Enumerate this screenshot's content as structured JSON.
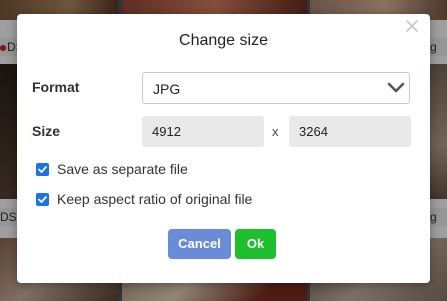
{
  "background": {
    "thumb_captions": [
      "DSC",
      "g",
      "DSC",
      "g"
    ]
  },
  "dialog": {
    "title": "Change size",
    "close_icon": "close-icon",
    "format": {
      "label": "Format",
      "selected": "JPG"
    },
    "size": {
      "label": "Size",
      "width": "4912",
      "separator": "x",
      "height": "3264"
    },
    "options": [
      {
        "label": "Save as separate file",
        "checked": true
      },
      {
        "label": "Keep aspect ratio of original file",
        "checked": true
      }
    ],
    "buttons": {
      "cancel": "Cancel",
      "ok": "Ok"
    },
    "colors": {
      "checkbox": "#1a73e8",
      "cancel": "#6a8bd8",
      "ok": "#1dbf2f"
    }
  }
}
